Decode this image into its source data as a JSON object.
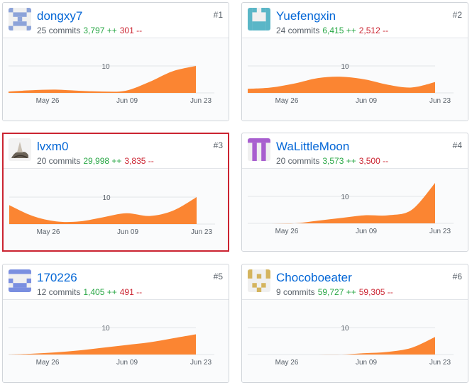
{
  "contributors": [
    {
      "name": "dongxy7",
      "commits": "25 commits",
      "additions": "3,797 ++",
      "deletions": "301 --",
      "rank": "#1",
      "avatar": "identicon-blue-x"
    },
    {
      "name": "Yuefengxin",
      "commits": "24 commits",
      "additions": "6,415 ++",
      "deletions": "2,512 --",
      "rank": "#2",
      "avatar": "identicon-teal"
    },
    {
      "name": "lvxm0",
      "commits": "20 commits",
      "additions": "29,998 ++",
      "deletions": "3,835 --",
      "rank": "#3",
      "avatar": "photo-avatar"
    },
    {
      "name": "WaLittleMoon",
      "commits": "20 commits",
      "additions": "3,573 ++",
      "deletions": "3,500 --",
      "rank": "#4",
      "avatar": "identicon-purple"
    },
    {
      "name": "170226",
      "commits": "12 commits",
      "additions": "1,405 ++",
      "deletions": "491 --",
      "rank": "#5",
      "avatar": "identicon-blue"
    },
    {
      "name": "Chocoboeater",
      "commits": "9 commits",
      "additions": "59,727 ++",
      "deletions": "59,305 --",
      "rank": "#6",
      "avatar": "identicon-gold"
    }
  ],
  "chart_data": {
    "type": "area",
    "x_ticks": [
      "May 26",
      "Jun 09",
      "Jun 23"
    ],
    "y_ticks": [
      10
    ],
    "series": [
      {
        "values": [
          0.5,
          1,
          1.2,
          0.8,
          0.5,
          0.8,
          4,
          8,
          10
        ]
      },
      {
        "values": [
          1.5,
          2,
          3.5,
          5.5,
          6,
          5,
          3,
          2,
          4
        ]
      },
      {
        "values": [
          7,
          3,
          1,
          1,
          2.5,
          4,
          3,
          5,
          10
        ]
      },
      {
        "values": [
          0,
          0,
          0,
          1,
          2,
          3,
          3,
          5,
          15
        ]
      },
      {
        "values": [
          0,
          0.3,
          0.8,
          1.5,
          2.5,
          3.5,
          4.5,
          6,
          7.5
        ]
      },
      {
        "values": [
          0,
          0,
          0,
          0,
          0,
          0.5,
          1,
          2.5,
          6.5
        ]
      }
    ]
  },
  "colors": {
    "area": "#fb8532",
    "link": "#0366d6",
    "add": "#28a745",
    "del": "#cb2431"
  }
}
